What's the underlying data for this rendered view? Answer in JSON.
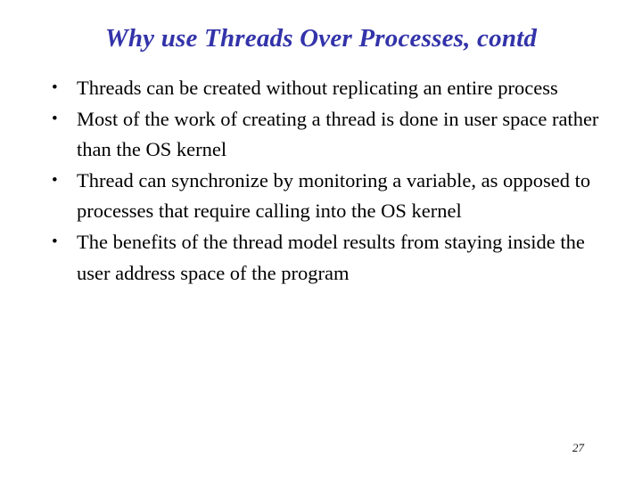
{
  "slide": {
    "title": "Why use Threads Over Processes, contd",
    "title_color": "#3333aa",
    "background_color": "#ffffff",
    "body_text_color": "#000000",
    "page_number": "27",
    "bullet_glyph": "•",
    "bullets": [
      {
        "text": "Threads can be created without replicating an entire process"
      },
      {
        "text": "Most of the work of creating a thread is done in user space rather than the OS kernel"
      },
      {
        "text": "Thread can synchronize by monitoring a variable, as opposed to processes that require calling into the OS kernel"
      },
      {
        "text": "The benefits of the thread model results from staying inside the user address space of the program"
      }
    ]
  }
}
